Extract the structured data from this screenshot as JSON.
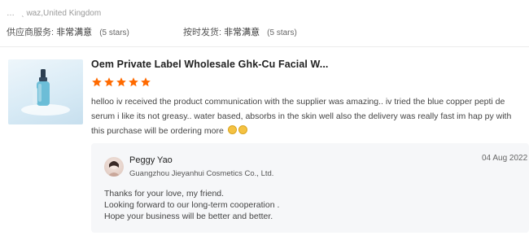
{
  "reviewer": {
    "location": "waz,United Kingdom"
  },
  "ratings": [
    {
      "label": "供应商服务:",
      "value": "非常满意",
      "stars": "(5 stars)"
    },
    {
      "label": "按时发货:",
      "value": "非常满意",
      "stars": "(5 stars)"
    }
  ],
  "product": {
    "title": "Oem Private Label Wholesale Ghk-Cu Facial W...",
    "image_icon": "serum-bottle-image",
    "rating": 5
  },
  "review": {
    "text": "helloo iv received the product communication with the supplier was amazing.. iv tried the blue copper pepti de serum i like its not greasy.. water based, absorbs in the skin well also the delivery was really fast im hap py with this purchase will be ordering more"
  },
  "reply": {
    "name": "Peggy Yao",
    "company": "Guangzhou Jieyanhui Cosmetics Co., Ltd.",
    "date": "04 Aug 2022",
    "lines": [
      "Thanks for your love, my friend.",
      "Looking forward to our long-term cooperation .",
      "Hope your business will be  better and better."
    ]
  },
  "colors": {
    "star": "#ff6a00",
    "reply_bg": "#f6f7f9"
  }
}
